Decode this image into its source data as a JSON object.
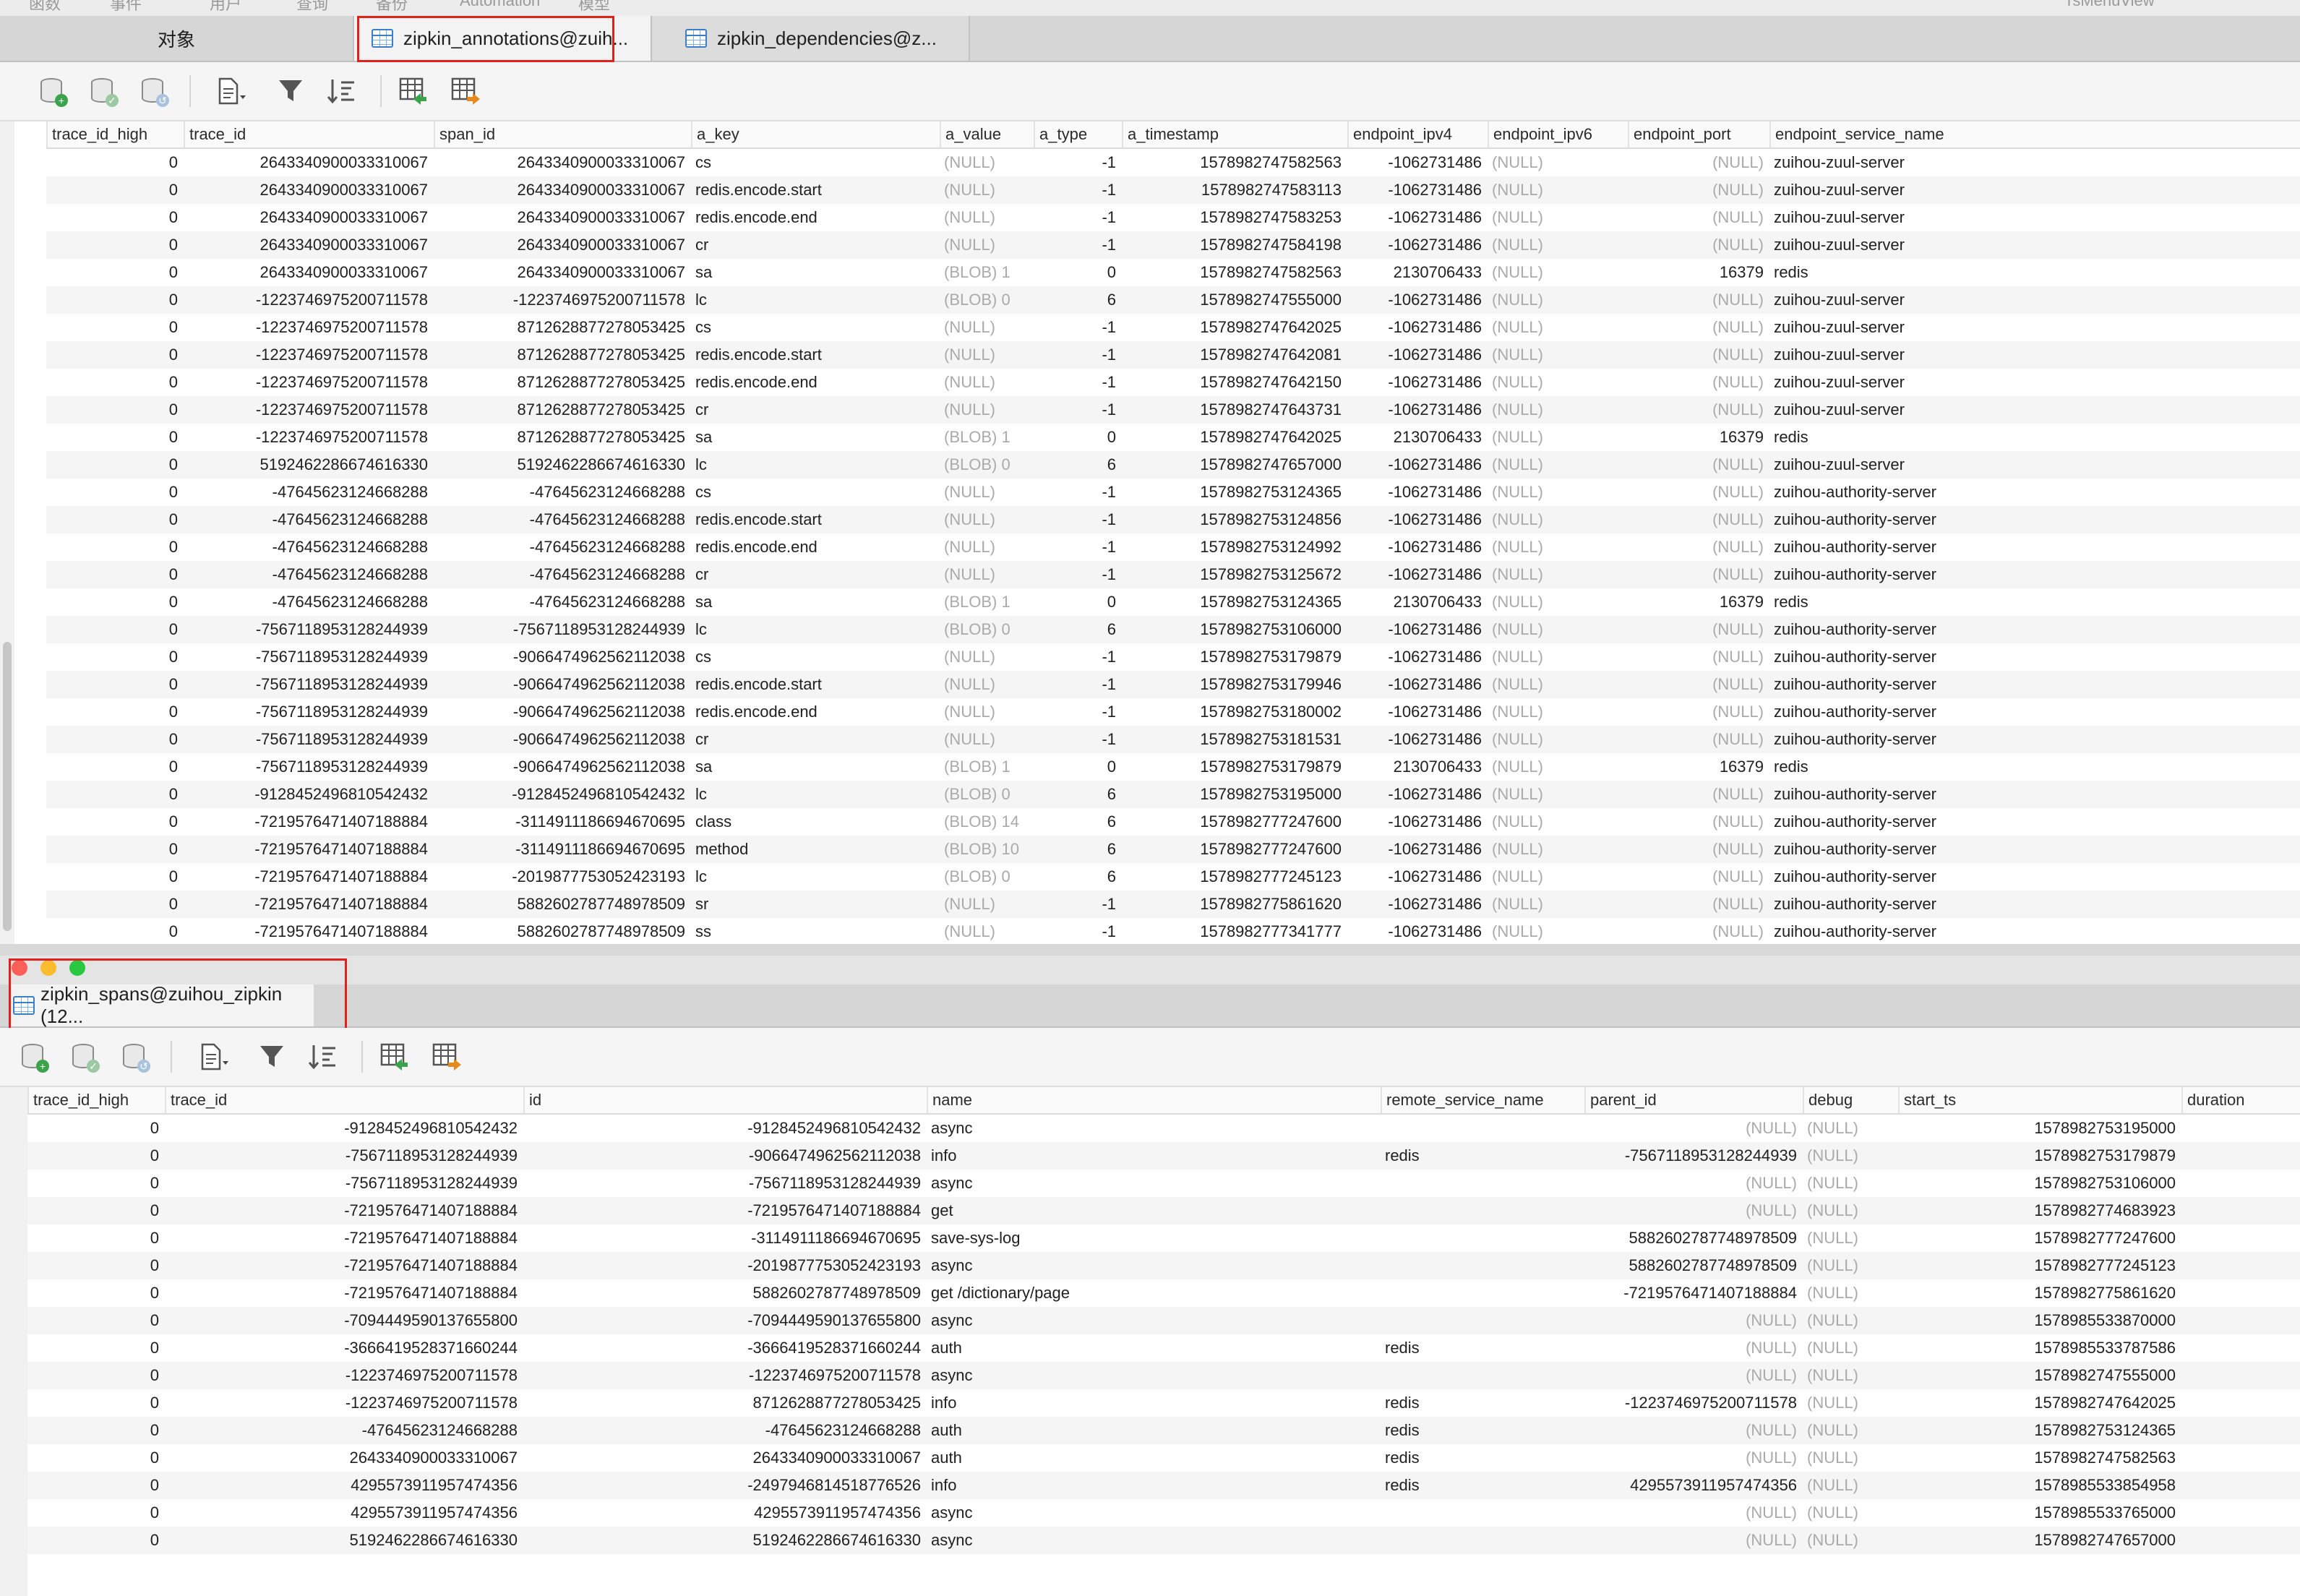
{
  "menu": {
    "items": [
      "函数",
      "事件",
      "用户",
      "查询",
      "备份",
      "Automation",
      "模型",
      "rsMenuView"
    ]
  },
  "tabs": {
    "objects": "对象",
    "annotations": "zipkin_annotations@zuih...",
    "dependencies": "zipkin_dependencies@z..."
  },
  "annotations": {
    "columns": [
      "trace_id_high",
      "trace_id",
      "span_id",
      "a_key",
      "a_value",
      "a_type",
      "a_timestamp",
      "endpoint_ipv4",
      "endpoint_ipv6",
      "endpoint_port",
      "endpoint_service_name"
    ],
    "rows": [
      [
        "0",
        "2643340900033310067",
        "2643340900033310067",
        "cs",
        "(NULL)",
        "-1",
        "1578982747582563",
        "-1062731486",
        "(NULL)",
        "(NULL)",
        "zuihou-zuul-server"
      ],
      [
        "0",
        "2643340900033310067",
        "2643340900033310067",
        "redis.encode.start",
        "(NULL)",
        "-1",
        "1578982747583113",
        "-1062731486",
        "(NULL)",
        "(NULL)",
        "zuihou-zuul-server"
      ],
      [
        "0",
        "2643340900033310067",
        "2643340900033310067",
        "redis.encode.end",
        "(NULL)",
        "-1",
        "1578982747583253",
        "-1062731486",
        "(NULL)",
        "(NULL)",
        "zuihou-zuul-server"
      ],
      [
        "0",
        "2643340900033310067",
        "2643340900033310067",
        "cr",
        "(NULL)",
        "-1",
        "1578982747584198",
        "-1062731486",
        "(NULL)",
        "(NULL)",
        "zuihou-zuul-server"
      ],
      [
        "0",
        "2643340900033310067",
        "2643340900033310067",
        "sa",
        "(BLOB) 1",
        "0",
        "1578982747582563",
        "2130706433",
        "(NULL)",
        "16379",
        "redis"
      ],
      [
        "0",
        "-1223746975200711578",
        "-1223746975200711578",
        "lc",
        "(BLOB) 0",
        "6",
        "1578982747555000",
        "-1062731486",
        "(NULL)",
        "(NULL)",
        "zuihou-zuul-server"
      ],
      [
        "0",
        "-1223746975200711578",
        "8712628877278053425",
        "cs",
        "(NULL)",
        "-1",
        "1578982747642025",
        "-1062731486",
        "(NULL)",
        "(NULL)",
        "zuihou-zuul-server"
      ],
      [
        "0",
        "-1223746975200711578",
        "8712628877278053425",
        "redis.encode.start",
        "(NULL)",
        "-1",
        "1578982747642081",
        "-1062731486",
        "(NULL)",
        "(NULL)",
        "zuihou-zuul-server"
      ],
      [
        "0",
        "-1223746975200711578",
        "8712628877278053425",
        "redis.encode.end",
        "(NULL)",
        "-1",
        "1578982747642150",
        "-1062731486",
        "(NULL)",
        "(NULL)",
        "zuihou-zuul-server"
      ],
      [
        "0",
        "-1223746975200711578",
        "8712628877278053425",
        "cr",
        "(NULL)",
        "-1",
        "1578982747643731",
        "-1062731486",
        "(NULL)",
        "(NULL)",
        "zuihou-zuul-server"
      ],
      [
        "0",
        "-1223746975200711578",
        "8712628877278053425",
        "sa",
        "(BLOB) 1",
        "0",
        "1578982747642025",
        "2130706433",
        "(NULL)",
        "16379",
        "redis"
      ],
      [
        "0",
        "5192462286674616330",
        "5192462286674616330",
        "lc",
        "(BLOB) 0",
        "6",
        "1578982747657000",
        "-1062731486",
        "(NULL)",
        "(NULL)",
        "zuihou-zuul-server"
      ],
      [
        "0",
        "-47645623124668288",
        "-47645623124668288",
        "cs",
        "(NULL)",
        "-1",
        "1578982753124365",
        "-1062731486",
        "(NULL)",
        "(NULL)",
        "zuihou-authority-server"
      ],
      [
        "0",
        "-47645623124668288",
        "-47645623124668288",
        "redis.encode.start",
        "(NULL)",
        "-1",
        "1578982753124856",
        "-1062731486",
        "(NULL)",
        "(NULL)",
        "zuihou-authority-server"
      ],
      [
        "0",
        "-47645623124668288",
        "-47645623124668288",
        "redis.encode.end",
        "(NULL)",
        "-1",
        "1578982753124992",
        "-1062731486",
        "(NULL)",
        "(NULL)",
        "zuihou-authority-server"
      ],
      [
        "0",
        "-47645623124668288",
        "-47645623124668288",
        "cr",
        "(NULL)",
        "-1",
        "1578982753125672",
        "-1062731486",
        "(NULL)",
        "(NULL)",
        "zuihou-authority-server"
      ],
      [
        "0",
        "-47645623124668288",
        "-47645623124668288",
        "sa",
        "(BLOB) 1",
        "0",
        "1578982753124365",
        "2130706433",
        "(NULL)",
        "16379",
        "redis"
      ],
      [
        "0",
        "-7567118953128244939",
        "-7567118953128244939",
        "lc",
        "(BLOB) 0",
        "6",
        "1578982753106000",
        "-1062731486",
        "(NULL)",
        "(NULL)",
        "zuihou-authority-server"
      ],
      [
        "0",
        "-7567118953128244939",
        "-9066474962562112038",
        "cs",
        "(NULL)",
        "-1",
        "1578982753179879",
        "-1062731486",
        "(NULL)",
        "(NULL)",
        "zuihou-authority-server"
      ],
      [
        "0",
        "-7567118953128244939",
        "-9066474962562112038",
        "redis.encode.start",
        "(NULL)",
        "-1",
        "1578982753179946",
        "-1062731486",
        "(NULL)",
        "(NULL)",
        "zuihou-authority-server"
      ],
      [
        "0",
        "-7567118953128244939",
        "-9066474962562112038",
        "redis.encode.end",
        "(NULL)",
        "-1",
        "1578982753180002",
        "-1062731486",
        "(NULL)",
        "(NULL)",
        "zuihou-authority-server"
      ],
      [
        "0",
        "-7567118953128244939",
        "-9066474962562112038",
        "cr",
        "(NULL)",
        "-1",
        "1578982753181531",
        "-1062731486",
        "(NULL)",
        "(NULL)",
        "zuihou-authority-server"
      ],
      [
        "0",
        "-7567118953128244939",
        "-9066474962562112038",
        "sa",
        "(BLOB) 1",
        "0",
        "1578982753179879",
        "2130706433",
        "(NULL)",
        "16379",
        "redis"
      ],
      [
        "0",
        "-9128452496810542432",
        "-9128452496810542432",
        "lc",
        "(BLOB) 0",
        "6",
        "1578982753195000",
        "-1062731486",
        "(NULL)",
        "(NULL)",
        "zuihou-authority-server"
      ],
      [
        "0",
        "-7219576471407188884",
        "-3114911186694670695",
        "class",
        "(BLOB) 14",
        "6",
        "1578982777247600",
        "-1062731486",
        "(NULL)",
        "(NULL)",
        "zuihou-authority-server"
      ],
      [
        "0",
        "-7219576471407188884",
        "-3114911186694670695",
        "method",
        "(BLOB) 10",
        "6",
        "1578982777247600",
        "-1062731486",
        "(NULL)",
        "(NULL)",
        "zuihou-authority-server"
      ],
      [
        "0",
        "-7219576471407188884",
        "-2019877753052423193",
        "lc",
        "(BLOB) 0",
        "6",
        "1578982777245123",
        "-1062731486",
        "(NULL)",
        "(NULL)",
        "zuihou-authority-server"
      ],
      [
        "0",
        "-7219576471407188884",
        "5882602787748978509",
        "sr",
        "(NULL)",
        "-1",
        "1578982775861620",
        "-1062731486",
        "(NULL)",
        "(NULL)",
        "zuihou-authority-server"
      ],
      [
        "0",
        "-7219576471407188884",
        "5882602787748978509",
        "ss",
        "(NULL)",
        "-1",
        "1578982777341777",
        "-1062731486",
        "(NULL)",
        "(NULL)",
        "zuihou-authority-server"
      ]
    ]
  },
  "spans_tab": "zipkin_spans@zuihou_zipkin (12...",
  "spans": {
    "columns": [
      "trace_id_high",
      "trace_id",
      "id",
      "name",
      "remote_service_name",
      "parent_id",
      "debug",
      "start_ts",
      "duration"
    ],
    "rows": [
      [
        "0",
        "-9128452496810542432",
        "-9128452496810542432",
        "async",
        "",
        "(NULL)",
        "(NULL)",
        "1578982753195000",
        ""
      ],
      [
        "0",
        "-7567118953128244939",
        "-9066474962562112038",
        "info",
        "redis",
        "-7567118953128244939",
        "(NULL)",
        "1578982753179879",
        ""
      ],
      [
        "0",
        "-7567118953128244939",
        "-7567118953128244939",
        "async",
        "",
        "(NULL)",
        "(NULL)",
        "1578982753106000",
        ""
      ],
      [
        "0",
        "-7219576471407188884",
        "-7219576471407188884",
        "get",
        "",
        "(NULL)",
        "(NULL)",
        "1578982774683923",
        ""
      ],
      [
        "0",
        "-7219576471407188884",
        "-3114911186694670695",
        "save-sys-log",
        "",
        "5882602787748978509",
        "(NULL)",
        "1578982777247600",
        ""
      ],
      [
        "0",
        "-7219576471407188884",
        "-2019877753052423193",
        "async",
        "",
        "5882602787748978509",
        "(NULL)",
        "1578982777245123",
        ""
      ],
      [
        "0",
        "-7219576471407188884",
        "5882602787748978509",
        "get /dictionary/page",
        "",
        "-7219576471407188884",
        "(NULL)",
        "1578982775861620",
        ""
      ],
      [
        "0",
        "-7094449590137655800",
        "-7094449590137655800",
        "async",
        "",
        "(NULL)",
        "(NULL)",
        "1578985533870000",
        ""
      ],
      [
        "0",
        "-3666419528371660244",
        "-3666419528371660244",
        "auth",
        "redis",
        "(NULL)",
        "(NULL)",
        "1578985533787586",
        ""
      ],
      [
        "0",
        "-1223746975200711578",
        "-1223746975200711578",
        "async",
        "",
        "(NULL)",
        "(NULL)",
        "1578982747555000",
        ""
      ],
      [
        "0",
        "-1223746975200711578",
        "8712628877278053425",
        "info",
        "redis",
        "-1223746975200711578",
        "(NULL)",
        "1578982747642025",
        ""
      ],
      [
        "0",
        "-47645623124668288",
        "-47645623124668288",
        "auth",
        "redis",
        "(NULL)",
        "(NULL)",
        "1578982753124365",
        ""
      ],
      [
        "0",
        "2643340900033310067",
        "2643340900033310067",
        "auth",
        "redis",
        "(NULL)",
        "(NULL)",
        "1578982747582563",
        ""
      ],
      [
        "0",
        "4295573911957474356",
        "-2497946814518776526",
        "info",
        "redis",
        "4295573911957474356",
        "(NULL)",
        "1578985533854958",
        ""
      ],
      [
        "0",
        "4295573911957474356",
        "4295573911957474356",
        "async",
        "",
        "(NULL)",
        "(NULL)",
        "1578985533765000",
        ""
      ],
      [
        "0",
        "5192462286674616330",
        "5192462286674616330",
        "async",
        "",
        "(NULL)",
        "(NULL)",
        "1578982747657000",
        ""
      ]
    ]
  },
  "colors": {
    "highlight_box": "#e0201b",
    "null_text": "#aaaaaa",
    "row_stripe": "#f5f5f5"
  }
}
